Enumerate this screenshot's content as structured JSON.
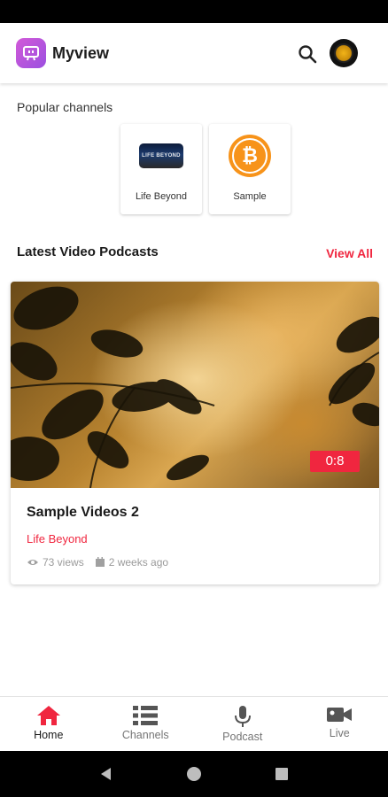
{
  "app": {
    "title": "Myview"
  },
  "header": {
    "search_icon": "search-icon",
    "avatar_icon": "profile-avatar"
  },
  "popular": {
    "label": "Popular channels",
    "channels": [
      {
        "name": "Life Beyond",
        "logo_text": "LIFE BEYOND"
      },
      {
        "name": "Sample",
        "logo_icon": "bitcoin-icon"
      }
    ]
  },
  "latest": {
    "title": "Latest Video Podcasts",
    "view_all": "View All",
    "videos": [
      {
        "title": "Sample Videos 2",
        "channel": "Life Beyond",
        "duration": "0:8",
        "views": "73 views",
        "posted": "2 weeks ago"
      }
    ]
  },
  "bottom_nav": {
    "items": [
      {
        "label": "Home",
        "icon": "home-icon",
        "active": true
      },
      {
        "label": "Channels",
        "icon": "list-icon",
        "active": false
      },
      {
        "label": "Podcast",
        "icon": "microphone-icon",
        "active": false
      },
      {
        "label": "Live",
        "icon": "video-camera-icon",
        "active": false
      }
    ]
  },
  "colors": {
    "accent": "#f0263f",
    "logo": "#b455dc",
    "bitcoin": "#f7931a"
  }
}
